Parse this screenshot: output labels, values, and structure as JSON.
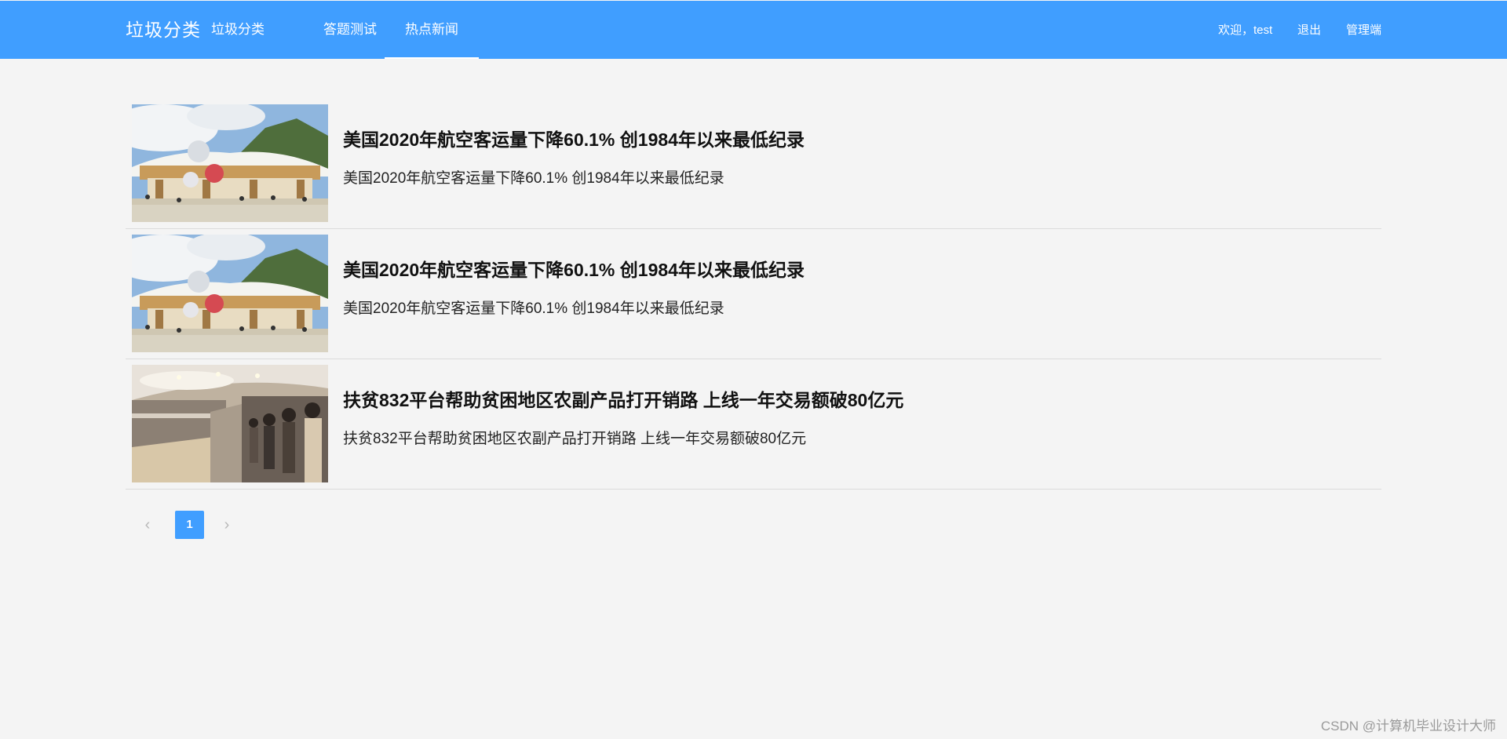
{
  "header": {
    "brand": "垃圾分类",
    "nav": [
      {
        "label": "垃圾分类"
      },
      {
        "label": "答题测试"
      },
      {
        "label": "热点新闻"
      }
    ],
    "welcome": "欢迎，test",
    "logout": "退出",
    "admin": "管理端",
    "background_color": "#409eff"
  },
  "news": [
    {
      "title": "美国2020年航空客运量下降60.1% 创1984年以来最低纪录",
      "summary": "美国2020年航空客运量下降60.1% 创1984年以来最低纪录",
      "image": "theme-park-photo"
    },
    {
      "title": "美国2020年航空客运量下降60.1% 创1984年以来最低纪录",
      "summary": "美国2020年航空客运量下降60.1% 创1984年以来最低纪录",
      "image": "theme-park-photo"
    },
    {
      "title": "扶贫832平台帮助贫困地区农副产品打开销路 上线一年交易额破80亿元",
      "summary": "扶贫832平台帮助贫困地区农副产品打开销路 上线一年交易额破80亿元",
      "image": "shopping-mall-queue-photo"
    }
  ],
  "pagination": {
    "prev": "‹",
    "current": "1",
    "next": "›"
  },
  "watermark": "CSDN @计算机毕业设计大师"
}
